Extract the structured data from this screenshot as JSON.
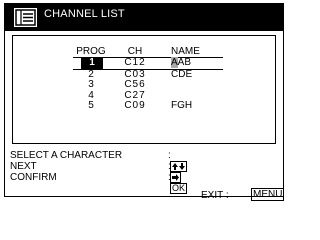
{
  "header": {
    "title": "CHANNEL LIST",
    "icon": "channel-list-icon"
  },
  "table": {
    "columns": {
      "prog": "PROG",
      "ch": "CH",
      "name": "NAME"
    },
    "rows": [
      {
        "prog": "1",
        "ch": "C12",
        "name_hl": "A",
        "name_rest": "AB"
      },
      {
        "prog": "2",
        "ch": "C03",
        "name_hl": "",
        "name_rest": "CDE"
      },
      {
        "prog": "3",
        "ch": "C56",
        "name_hl": "",
        "name_rest": ""
      },
      {
        "prog": "4",
        "ch": "C27",
        "name_hl": "",
        "name_rest": ""
      },
      {
        "prog": "5",
        "ch": "C09",
        "name_hl": "",
        "name_rest": "FGH"
      }
    ]
  },
  "footer": {
    "select_label": "SELECT A CHARACTER",
    "next_label": "NEXT",
    "confirm_label": "CONFIRM",
    "colon": ":",
    "ok_key": "OK",
    "exit_label": "EXIT :",
    "menu_key": "MENU"
  },
  "colors": {
    "header_bg": "#000000",
    "selection_bg": "#000000",
    "cursor_highlight": "#a9a9a9"
  }
}
